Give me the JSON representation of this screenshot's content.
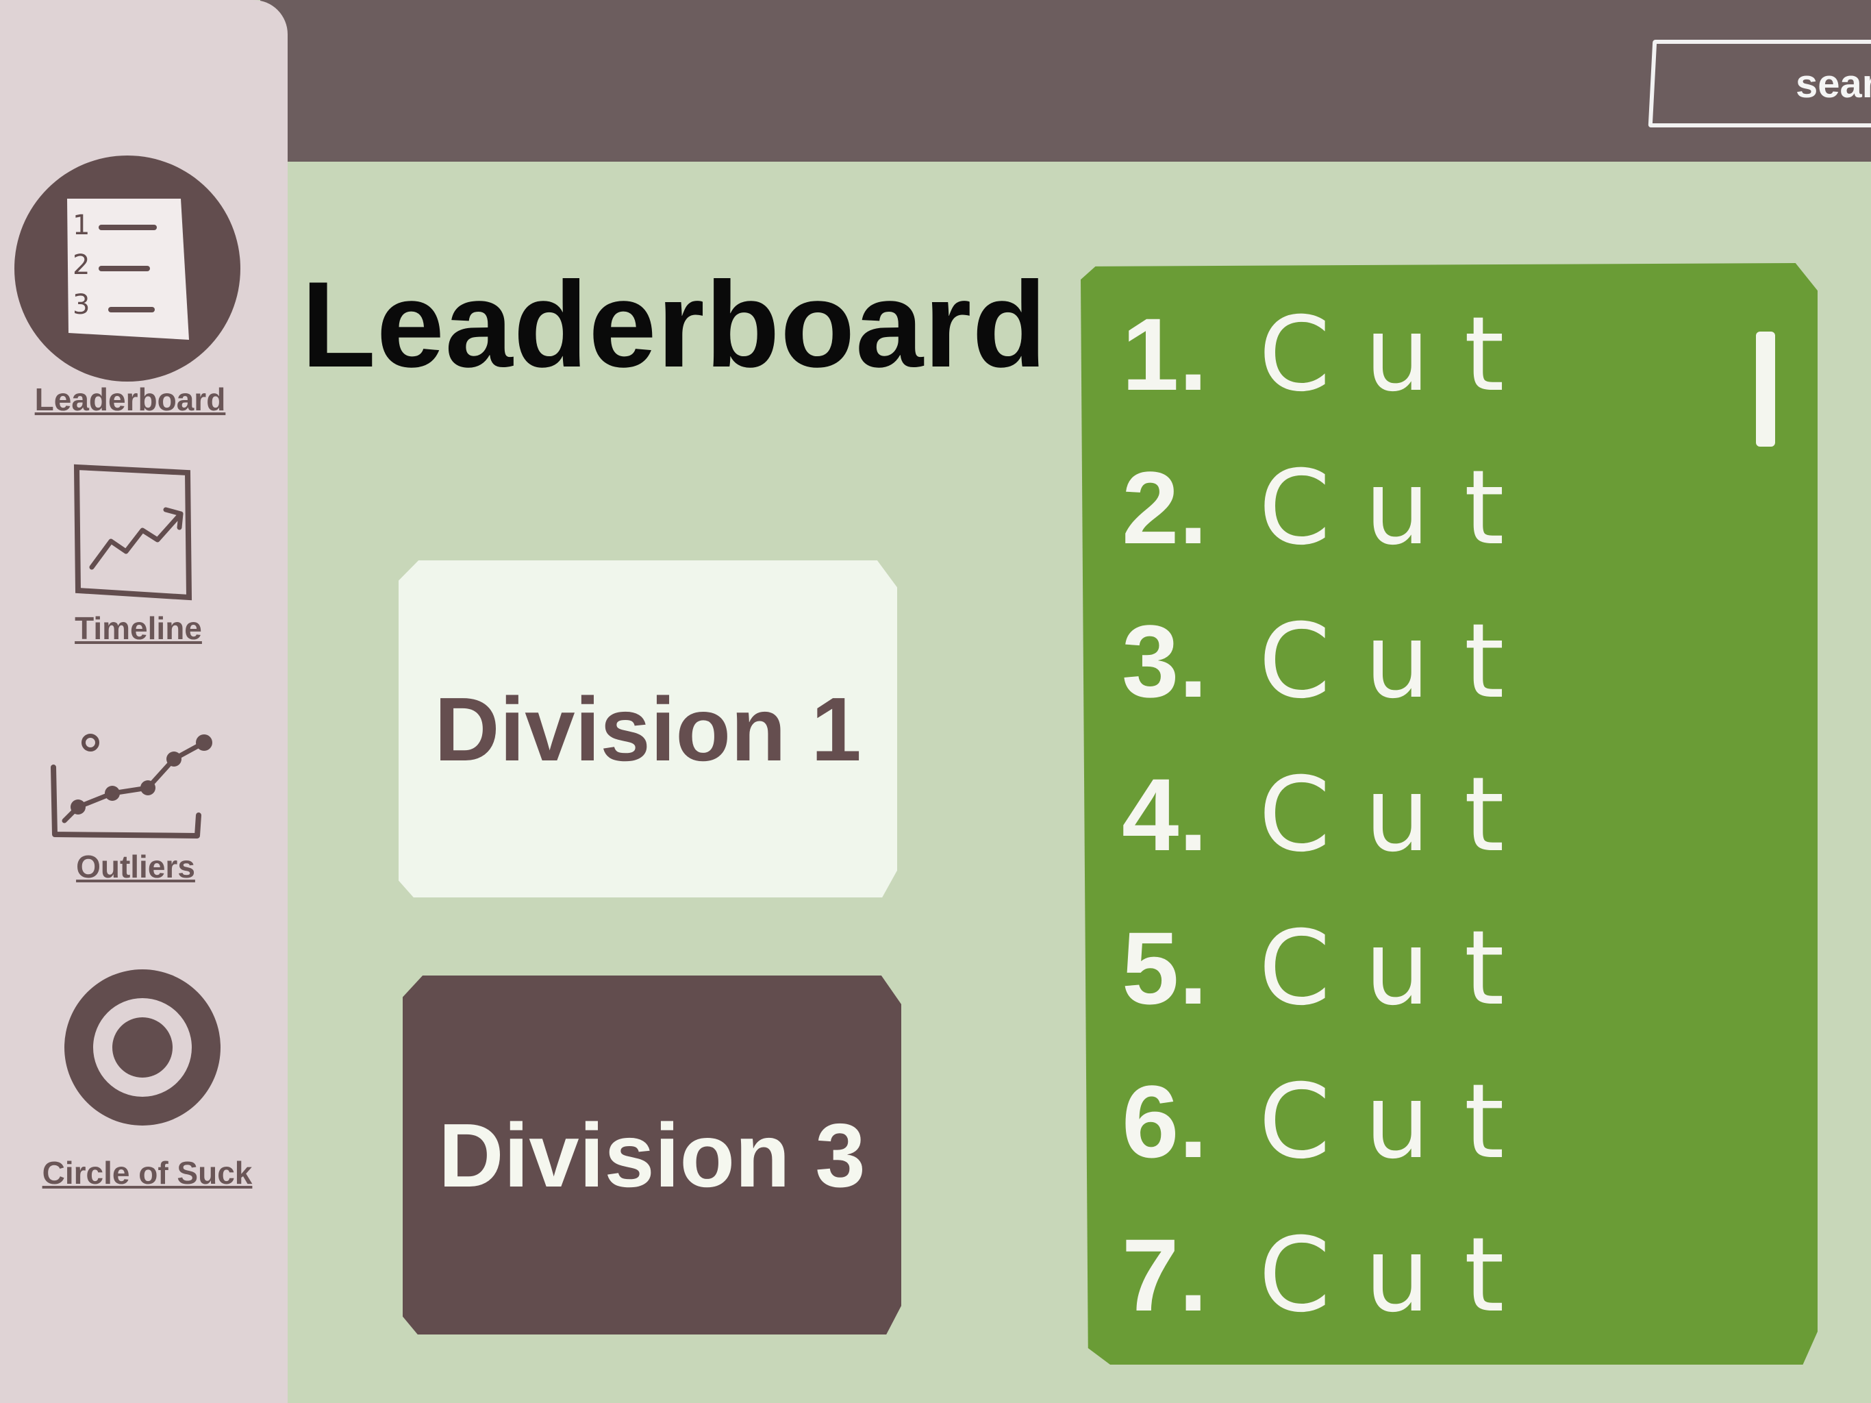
{
  "header": {
    "search_placeholder": "search..."
  },
  "sidebar": {
    "items": [
      {
        "label": "Leaderboard",
        "icon": "leaderboard-list-icon",
        "active": true
      },
      {
        "label": "Timeline",
        "icon": "trend-chart-icon"
      },
      {
        "label": "Outliers",
        "icon": "scatter-plot-icon"
      },
      {
        "label": "Circle of Suck",
        "icon": "target-icon"
      }
    ]
  },
  "main": {
    "title": "Leaderboard",
    "divisions": [
      {
        "label": "Division 1",
        "selected": false
      },
      {
        "label": "Division 3",
        "selected": true
      }
    ],
    "ranking": [
      {
        "rank": "1.",
        "name": "Cut"
      },
      {
        "rank": "2.",
        "name": "Cut"
      },
      {
        "rank": "3.",
        "name": "Cut"
      },
      {
        "rank": "4.",
        "name": "Cut"
      },
      {
        "rank": "5.",
        "name": "Cut"
      },
      {
        "rank": "6.",
        "name": "Cut"
      },
      {
        "rank": "7.",
        "name": "Cut"
      }
    ]
  },
  "colors": {
    "background": "#c8d7b9",
    "topbar": "#6c5d5e",
    "sidebar": "#dfd3d5",
    "accent_dark": "#624d4e",
    "ranking_panel": "#6a9c36",
    "division_light": "#f0f6ec"
  }
}
